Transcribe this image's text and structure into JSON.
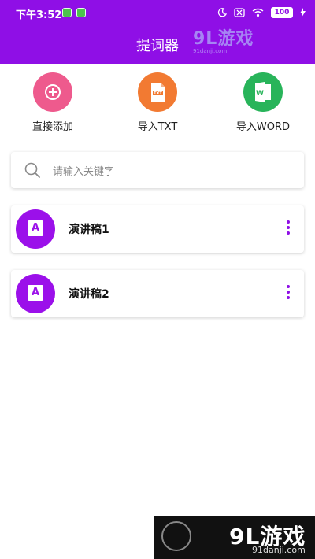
{
  "status_bar": {
    "time": "下午3:52",
    "battery": "100"
  },
  "header": {
    "title": "提词器"
  },
  "watermark": {
    "top_logo": "9L游戏",
    "top_url": "91danji.com",
    "bottom_logo": "9L游戏",
    "bottom_url": "91danji.com"
  },
  "actions": [
    {
      "label": "直接添加",
      "icon": "plus-icon",
      "color": "#ee5a8d"
    },
    {
      "label": "导入TXT",
      "icon": "txt-file-icon",
      "color": "#f27a32"
    },
    {
      "label": "导入WORD",
      "icon": "word-file-icon",
      "color": "#28b45a"
    }
  ],
  "search": {
    "placeholder": "请输入关键字"
  },
  "scripts": [
    {
      "name": "演讲稿1"
    },
    {
      "name": "演讲稿2"
    }
  ],
  "accent_color": "#8f0fe6"
}
